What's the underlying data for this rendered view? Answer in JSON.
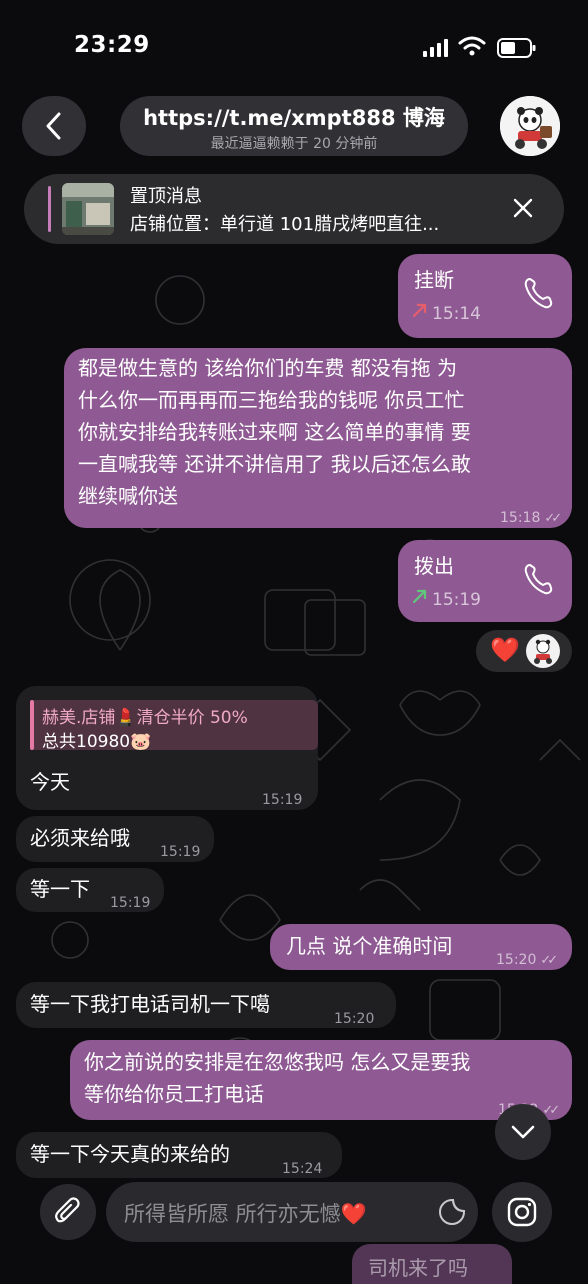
{
  "status_bar": {
    "time": "23:29"
  },
  "header": {
    "title": "https://t.me/xmpt888 博海",
    "subtitle": "最近逼逼赖赖于 20 分钟前"
  },
  "pinned": {
    "title": "置顶消息",
    "text": "店铺位置：单行道 101腊戌烤吧直往..."
  },
  "messages": [
    {
      "type": "call",
      "direction": "out",
      "label": "挂断",
      "time": "15:14",
      "status": "missed"
    },
    {
      "type": "text",
      "direction": "out",
      "lines": [
        "都是做生意的 该给你们的车费 都没有拖 为",
        "什么你一而再再而三拖给我的钱呢 你员工忙",
        "你就安排给我转账过来啊 这么简单的事情 要",
        "一直喊我等 还讲不讲信用了 我以后还怎么敢",
        "继续喊你送"
      ],
      "time": "15:18"
    },
    {
      "type": "call",
      "direction": "out",
      "label": "拨出",
      "time": "15:19",
      "status": "outgoing"
    },
    {
      "type": "reply",
      "direction": "in",
      "quote_name": "赫美.店铺💄清仓半价 50%",
      "quote_text": "总共10980🐷",
      "text": "今天",
      "time": "15:19"
    },
    {
      "type": "text",
      "direction": "in",
      "text": "必须来给哦",
      "time": "15:19"
    },
    {
      "type": "text",
      "direction": "in",
      "text": "等一下",
      "time": "15:19"
    },
    {
      "type": "text",
      "direction": "out",
      "text": "几点 说个准确时间",
      "time": "15:20"
    },
    {
      "type": "text",
      "direction": "in",
      "text": "等一下我打电话司机一下噶",
      "time": "15:20"
    },
    {
      "type": "text",
      "direction": "out",
      "lines": [
        "你之前说的安排是在忽悠我吗 怎么又是要我",
        "等你给你员工打电话"
      ],
      "time": "15:22"
    },
    {
      "type": "text",
      "direction": "in",
      "text": "等一下今天真的来给的",
      "time": "15:24"
    },
    {
      "type": "text",
      "direction": "out",
      "text": "司机来了吗",
      "partial": true
    }
  ],
  "reaction": {
    "emoji": "❤️"
  },
  "composer": {
    "placeholder": "所得皆所愿 所行亦无憾❤️"
  },
  "colors": {
    "outgoing_bubble": "#8f5a93",
    "incoming_bubble": "#1f1f22",
    "background": "#0b0b0d"
  }
}
